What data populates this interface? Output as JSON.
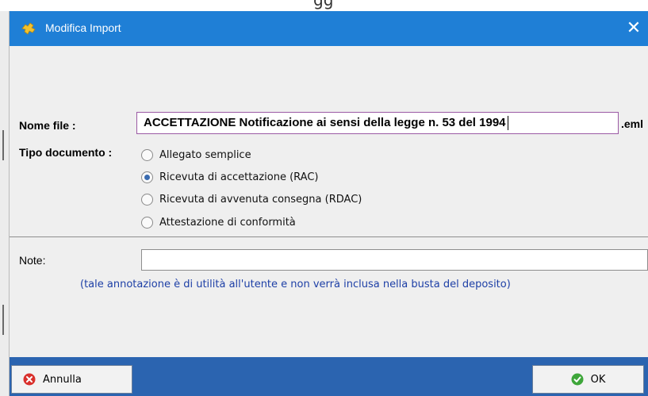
{
  "window": {
    "title": "Modifica Import",
    "close_glyph": "✕"
  },
  "form": {
    "filename_label": "Nome file :",
    "filename_value": "ACCETTAZIONE Notificazione ai sensi della legge n. 53 del 1994",
    "filename_ext": ".eml",
    "doctype_label": "Tipo documento :",
    "doctype_options": [
      {
        "label": "Allegato semplice",
        "selected": false
      },
      {
        "label": "Ricevuta di accettazione (RAC)",
        "selected": true
      },
      {
        "label": "Ricevuta di avvenuta consegna (RDAC)",
        "selected": false
      },
      {
        "label": "Attestazione di conformità",
        "selected": false
      }
    ],
    "note_label": "Note:",
    "note_value": "",
    "note_hint": "(tale annotazione è di utilità all'utente e non verrà inclusa nella busta del deposito)"
  },
  "buttons": {
    "cancel_label": "Annulla",
    "ok_label": "OK"
  },
  "icons": {
    "app": "puzzle-icon",
    "cancel": "cancel-icon",
    "ok": "check-icon"
  },
  "colors": {
    "titlebar": "#1f7fd6",
    "footer": "#2b64b0",
    "hint_text": "#1d3fa6",
    "filename_border": "#9b5aa4"
  }
}
